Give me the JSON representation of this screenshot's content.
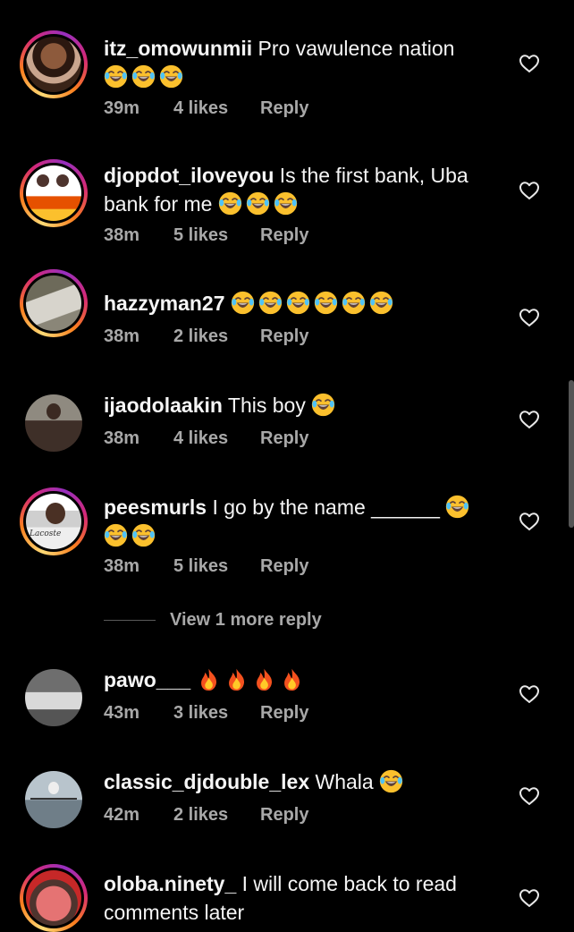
{
  "comments": [
    {
      "username": "itz_omowunmii",
      "text": "Pro vawulence nation",
      "time": "39m",
      "likes": "4 likes",
      "reply": "Reply"
    },
    {
      "username": "djopdot_iloveyou",
      "text": "Is the first bank, Uba bank for me",
      "time": "38m",
      "likes": "5 likes",
      "reply": "Reply"
    },
    {
      "username": "hazzyman27",
      "text": "",
      "time": "38m",
      "likes": "2 likes",
      "reply": "Reply"
    },
    {
      "username": "ijaodolaakin",
      "text": "This boy",
      "time": "38m",
      "likes": "4 likes",
      "reply": "Reply"
    },
    {
      "username": "peesmurls",
      "text": "I go by the name ______",
      "time": "38m",
      "likes": "5 likes",
      "reply": "Reply"
    },
    {
      "username": "pawo___",
      "text": "",
      "time": "43m",
      "likes": "3 likes",
      "reply": "Reply"
    },
    {
      "username": "classic_djdouble_lex",
      "text": "Whala",
      "time": "42m",
      "likes": "2 likes",
      "reply": "Reply"
    },
    {
      "username": "oloba.ninety_",
      "text": "I will come back to read comments later",
      "time": "",
      "likes": "",
      "reply": ""
    }
  ],
  "view_more_replies": "View 1 more reply",
  "icons": {
    "like": "heart-outline-icon",
    "laughing": "face-with-tears-of-joy-emoji",
    "fire": "fire-emoji"
  },
  "colors": {
    "background": "#000000",
    "text": "#f5f5f5",
    "secondary": "#a8a8a8"
  },
  "avatar_text": {
    "peesmurls": "Lacoste"
  }
}
